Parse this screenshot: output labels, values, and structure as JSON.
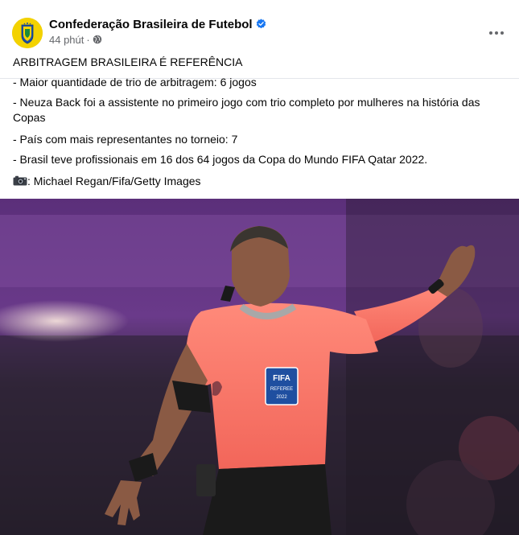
{
  "header": {
    "page_name": "Confederação Brasileira de Futebol",
    "time": "44 phút",
    "separator": "·"
  },
  "icons": {
    "verified": "verified-badge-icon",
    "audience": "globe-icon",
    "menu": "more-options-icon",
    "camera": "camera-emoji-icon"
  },
  "colors": {
    "verified_badge": "#1877f2",
    "meta_text": "#65676b",
    "crest_yellow": "#f3d200",
    "jersey": "#ff7a6b"
  },
  "post": {
    "headline": "ARBITRAGEM BRASILEIRA É REFERÊNCIA",
    "lines": [
      "- Maior quantidade de trio de arbitragem: 6 jogos",
      "- Neuza Back foi a assistente no primeiro jogo com trio completo por mulheres na história das Copas",
      "- País com mais representantes no torneio: 7",
      "- Brasil teve profissionais em 16 dos 64 jogos da Copa do Mundo FIFA Qatar 2022."
    ],
    "photo_credit": ": Michael Regan/Fifa/Getty Images"
  },
  "photo": {
    "badge_text": "FIFA",
    "badge_sub": "REFEREE",
    "badge_year": "2022"
  }
}
